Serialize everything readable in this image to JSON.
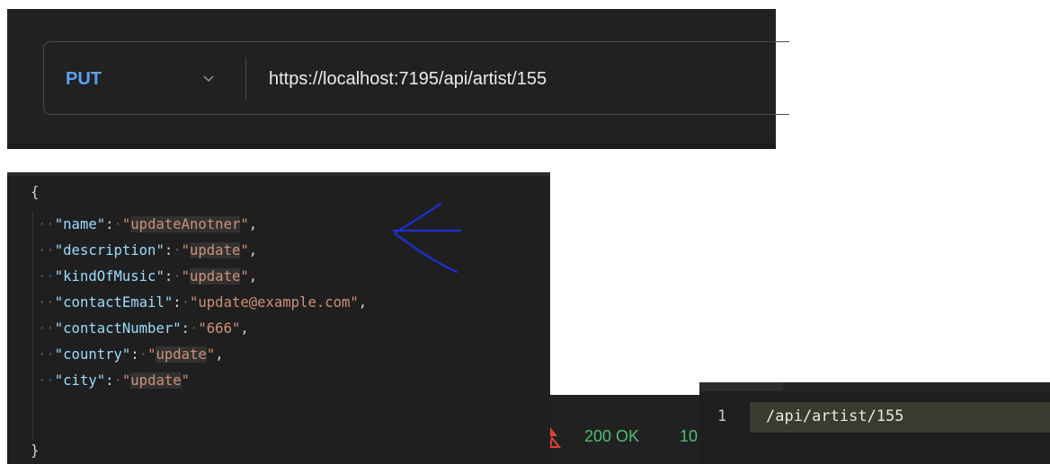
{
  "request": {
    "method": "PUT",
    "url": "https://localhost:7195/api/artist/155"
  },
  "body_editor": {
    "open_brace": "{",
    "close_brace": "}",
    "lines": [
      {
        "key": "name",
        "value": "updateAnotner",
        "comma": ","
      },
      {
        "key": "description",
        "value": "update",
        "comma": ","
      },
      {
        "key": "kindOfMusic",
        "value": "update",
        "comma": ","
      },
      {
        "key": "contactEmail",
        "value": "update@example.com",
        "comma": ","
      },
      {
        "key": "contactNumber",
        "value": "666",
        "comma": ","
      },
      {
        "key": "country",
        "value": "update",
        "comma": ","
      },
      {
        "key": "city",
        "value": "update",
        "comma": ""
      }
    ]
  },
  "annotation": {
    "arrow_color": "#1f2fd6"
  },
  "response": {
    "status": "200 OK",
    "time": "10",
    "status_color": "#4ec074"
  },
  "path_editor": {
    "line_number": "1",
    "path": "/api/artist/155"
  },
  "colors": {
    "method": "#5aa2f0",
    "json_key": "#9cdcfe",
    "json_string": "#ce9178",
    "panel_bg": "#212121"
  }
}
